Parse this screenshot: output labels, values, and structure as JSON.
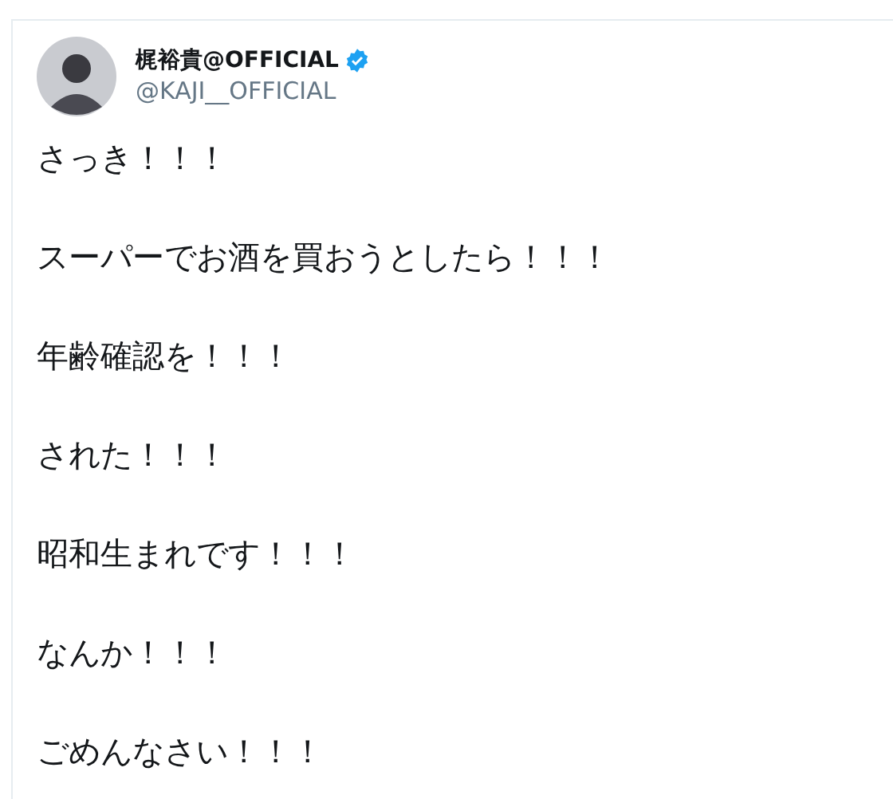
{
  "author": {
    "name": "梶裕貴@OFFICIAL",
    "verified": true,
    "handle": "@KAJI__OFFICIAL"
  },
  "tweet": {
    "lines": [
      "さっき！！！",
      "スーパーでお酒を買おうとしたら！！！",
      "年齢確認を！！！",
      "された！！！",
      "昭和生まれです！！！",
      "なんか！！！",
      "ごめんなさい！！！"
    ]
  }
}
